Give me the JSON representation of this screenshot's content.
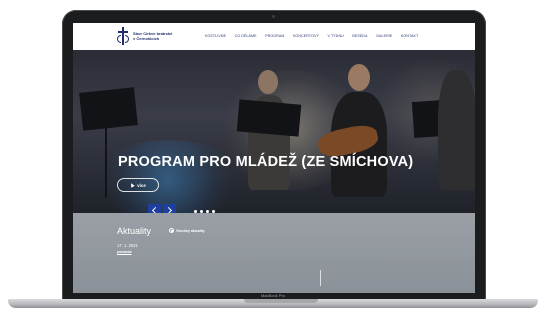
{
  "site": {
    "logo_lines": [
      "Sbor Církve bratrské",
      "v Černošicích"
    ],
    "nav": [
      "KOSTLIVNE",
      "CO DĚLÁME",
      "PROGRAM",
      "KONCERTOVÝ",
      "V TÝDNU",
      "BESEDA",
      "GALERIE",
      "KONTAKT"
    ]
  },
  "hero": {
    "title": "PROGRAM PRO MLÁDEŽ (ZE SMÍCHOVA)",
    "more_label": "více",
    "slide_count": 4
  },
  "news": {
    "title": "Aktuality",
    "all_label": "Všechny aktuality",
    "date": "17. 1. 2021",
    "link": "pozvánka"
  },
  "device": {
    "label": "MacBook Pro"
  },
  "colors": {
    "brand": "#1f2c6e",
    "arrow_bg": "#1d3fa0",
    "news_bg": "#9a9fa6"
  }
}
